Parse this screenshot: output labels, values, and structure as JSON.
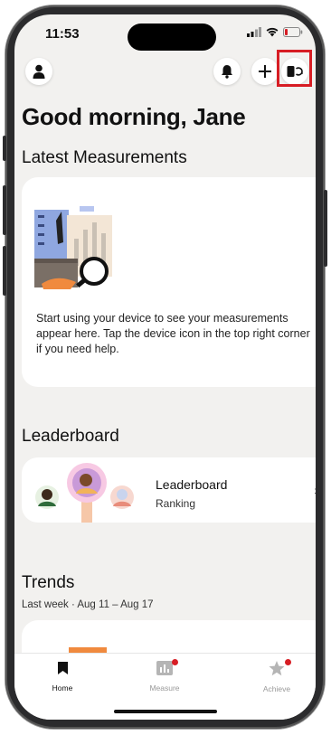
{
  "status_bar": {
    "time": "11:53"
  },
  "header": {
    "profile_icon": "person-icon",
    "notifications_icon": "bell-icon",
    "add_icon": "plus-icon",
    "device_icon": "device-sync-icon"
  },
  "greeting": "Good morning, Jane",
  "latest": {
    "title": "Latest Measurements",
    "empty_text": "Start using your device to see your measurements appear here. Tap the device icon in the top right corner if you need help."
  },
  "leaderboard": {
    "title": "Leaderboard",
    "card_title": "Leaderboard",
    "card_subtitle": "Ranking",
    "chevron": "›"
  },
  "trends": {
    "title": "Trends",
    "subtitle": "Last week · Aug 11 – Aug 17"
  },
  "tabs": [
    {
      "label": "Home",
      "icon": "bookmark-icon",
      "active": true,
      "badge": false
    },
    {
      "label": "Measure",
      "icon": "chart-icon",
      "active": false,
      "badge": true
    },
    {
      "label": "Achieve",
      "icon": "star-icon",
      "active": false,
      "badge": true
    }
  ],
  "colors": {
    "accent": "#d71d24",
    "background": "#f2f1ef"
  }
}
